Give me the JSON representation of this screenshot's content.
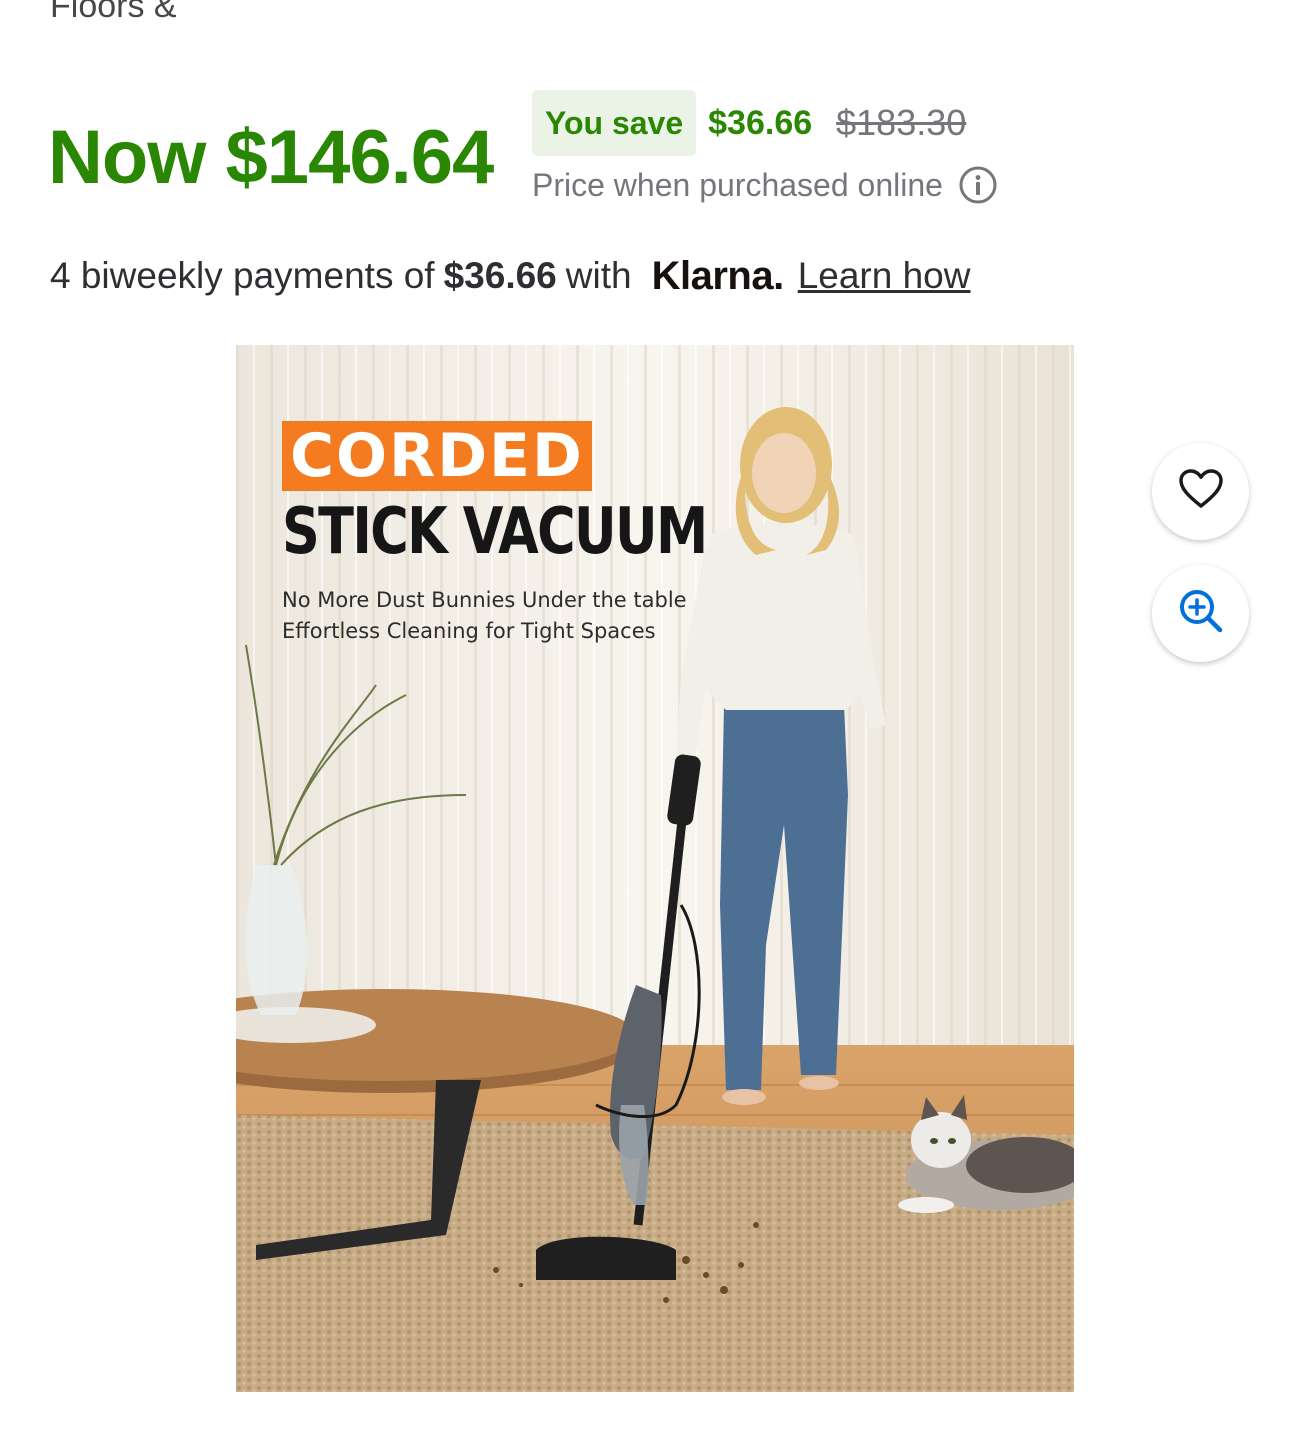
{
  "breadcrumb": {
    "fragment": "Floors &"
  },
  "price": {
    "now": "Now $146.64",
    "save_label": "You save",
    "save_amount": "$36.66",
    "was_price": "$183.30",
    "note": "Price when purchased online"
  },
  "financing": {
    "prefix": "4 biweekly payments of",
    "amount": "$36.66",
    "with": "with",
    "provider": "Klarna.",
    "link": "Learn how"
  },
  "product_image": {
    "banner": "CORDED",
    "headline": "STICK VACUUM",
    "line1": "No More Dust Bunnies Under the table",
    "line2": "Effortless Cleaning for Tight Spaces"
  },
  "actions": {
    "favorite_icon": "heart-icon",
    "zoom_icon": "zoom-in-icon"
  },
  "colors": {
    "price_green": "#2a8703",
    "badge_bg": "#eaf3e6",
    "zoom_blue": "#0071dc",
    "banner_orange": "#f47b20"
  }
}
